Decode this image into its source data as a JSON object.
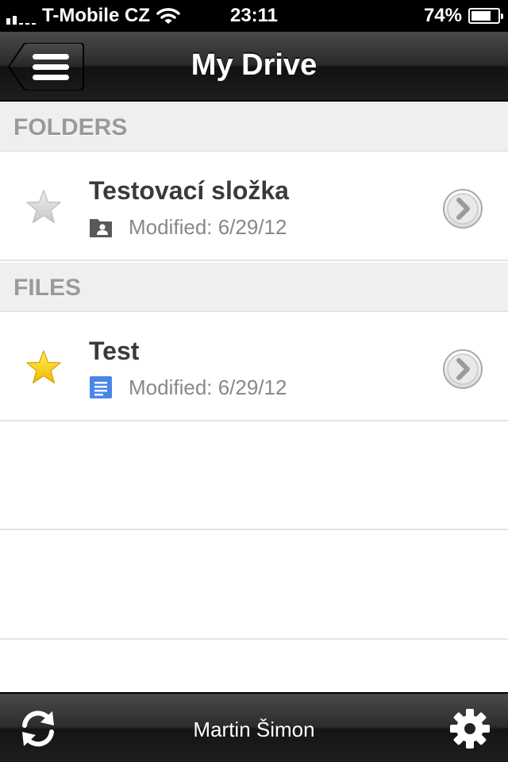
{
  "status_bar": {
    "carrier": "T-Mobile CZ",
    "time": "23:11",
    "battery_percent": "74%",
    "battery_level": 0.74
  },
  "nav_bar": {
    "title": "My Drive",
    "menu_icon": "menu-icon"
  },
  "sections": {
    "folders_label": "FOLDERS",
    "files_label": "FILES"
  },
  "folders": [
    {
      "name": "Testovací složka",
      "modified": "Modified: 6/29/12",
      "starred": false,
      "type_icon": "shared-folder-icon"
    }
  ],
  "files": [
    {
      "name": "Test",
      "modified": "Modified: 6/29/12",
      "starred": true,
      "type_icon": "document-icon"
    }
  ],
  "toolbar": {
    "user_name": "Martin Šimon",
    "refresh_icon": "refresh-icon",
    "settings_icon": "gear-icon"
  },
  "colors": {
    "star_active": "#f5c400",
    "star_inactive": "#d4d4d4",
    "doc_blue": "#4a86e8",
    "section_text": "#9a9a9a"
  }
}
